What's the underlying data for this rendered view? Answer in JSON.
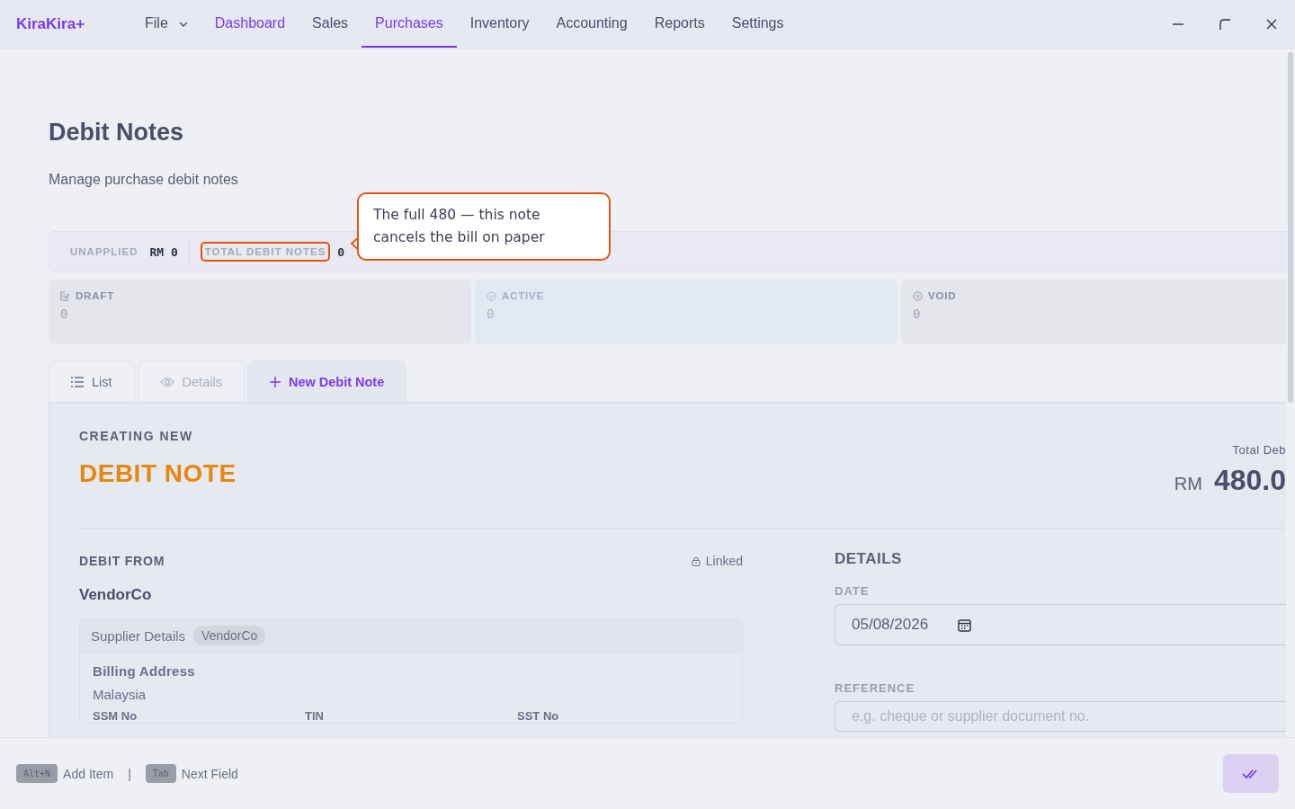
{
  "app": {
    "logo": "KiraKira+"
  },
  "menu": [
    {
      "label": "File",
      "kind": "dropdown",
      "selected": false,
      "highlighted": false
    },
    {
      "label": "Dashboard",
      "kind": "link",
      "selected": false,
      "highlighted": true
    },
    {
      "label": "Sales",
      "kind": "link",
      "selected": false,
      "highlighted": false
    },
    {
      "label": "Purchases",
      "kind": "link",
      "selected": true,
      "highlighted": false
    },
    {
      "label": "Inventory",
      "kind": "link",
      "selected": false,
      "highlighted": false
    },
    {
      "label": "Accounting",
      "kind": "link",
      "selected": false,
      "highlighted": false
    },
    {
      "label": "Reports",
      "kind": "link",
      "selected": false,
      "highlighted": false
    },
    {
      "label": "Settings",
      "kind": "link",
      "selected": false,
      "highlighted": false
    }
  ],
  "page": {
    "title": "Debit Notes",
    "subtitle": "Manage purchase debit notes"
  },
  "summary": [
    {
      "label": "UNAPPLIED",
      "value": "RM 0",
      "highlighted": false
    },
    {
      "label": "TOTAL DEBIT NOTES",
      "value": "0",
      "highlighted": true
    }
  ],
  "tooltip": {
    "text": "The full 480 — this note cancels the bill on paper"
  },
  "stats": [
    {
      "kind": "draft",
      "label": "DRAFT",
      "value": "0"
    },
    {
      "kind": "active",
      "label": "ACTIVE",
      "value": "0"
    },
    {
      "kind": "void",
      "label": "VOID",
      "value": "0"
    }
  ],
  "tabs": [
    {
      "kind": "list",
      "label": "List",
      "selected": false,
      "disabled": false
    },
    {
      "kind": "details",
      "label": "Details",
      "selected": false,
      "disabled": true
    },
    {
      "kind": "new",
      "label": "New Debit Note",
      "selected": true,
      "disabled": false
    }
  ],
  "form": {
    "eyebrow": "CREATING NEW",
    "title": "DEBIT NOTE",
    "total_label": "Total Deb",
    "currency": "RM",
    "total": "480.0",
    "debit_from": {
      "heading": "DEBIT FROM",
      "lock_label": "Linked",
      "supplier": "VendorCo",
      "card_title": "Supplier Details",
      "card_tag": "VendorCo",
      "billing_label": "Billing Address",
      "billing_value": "Malaysia",
      "columns": [
        "SSM No",
        "TIN",
        "SST No"
      ]
    },
    "details": {
      "heading": "DETAILS",
      "date_label": "DATE",
      "date_value": "05/08/2026",
      "reference_label": "REFERENCE",
      "reference_placeholder": "e.g. cheque or supplier document no."
    }
  },
  "footer": {
    "hints": [
      {
        "key": "Alt+N",
        "label": "Add Item"
      },
      {
        "key": "Tab",
        "label": "Next Field"
      }
    ],
    "separator": "|"
  }
}
